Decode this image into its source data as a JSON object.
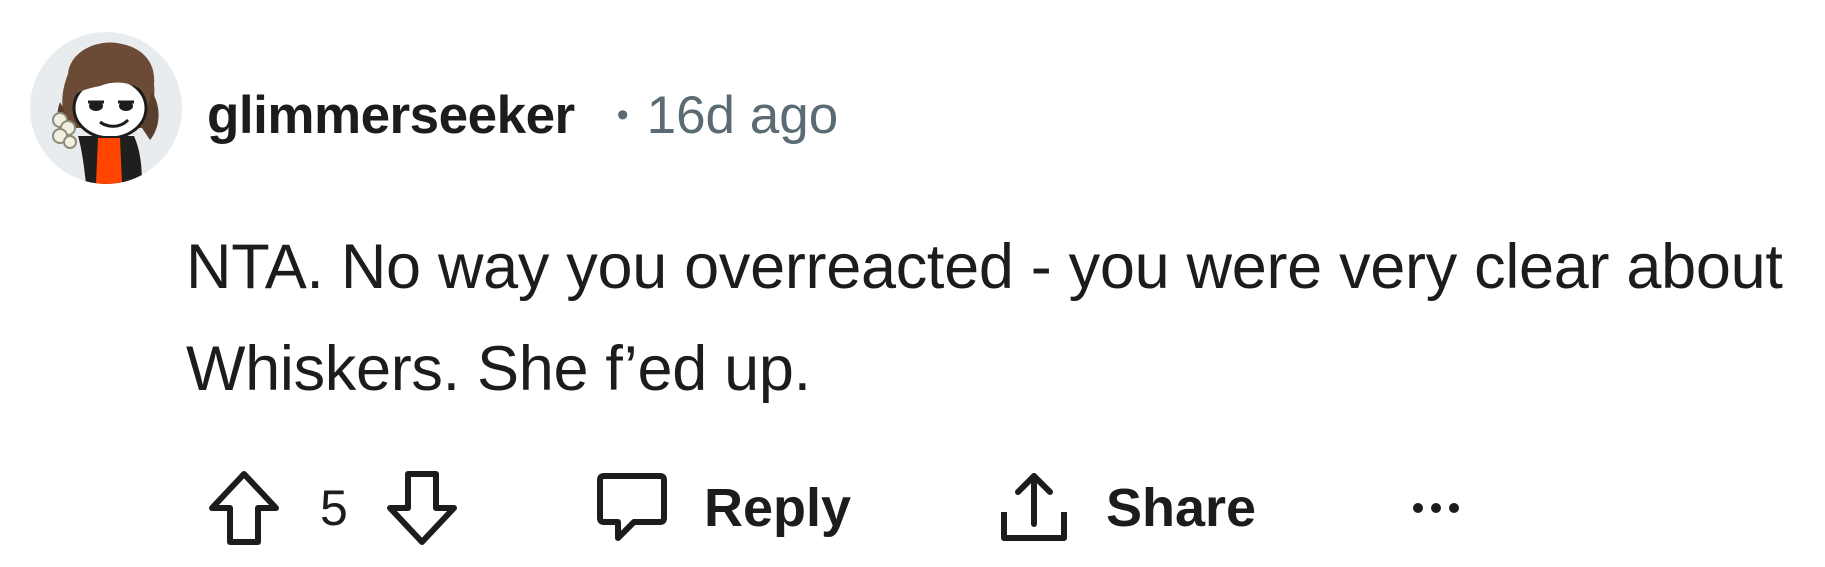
{
  "comment": {
    "author": "glimmerseeker",
    "separator": "•",
    "timestamp": "16d ago",
    "body": "NTA. No way you overreacted - you were very clear about Whiskers. She f’ed up.",
    "avatar_icon": "snoo-avatar-icon"
  },
  "actions": {
    "upvote_icon": "upvote-arrow-icon",
    "vote_count": "5",
    "downvote_icon": "downvote-arrow-icon",
    "reply_icon": "speech-bubble-icon",
    "reply_label": "Reply",
    "share_icon": "share-upload-icon",
    "share_label": "Share",
    "more_icon": "more-options-icon",
    "more_label": "•••"
  },
  "colors": {
    "text": "#1c1c1c",
    "meta": "#5a6b73",
    "avatar_bg": "#e9ecee",
    "accent_orange": "#ff4500"
  }
}
